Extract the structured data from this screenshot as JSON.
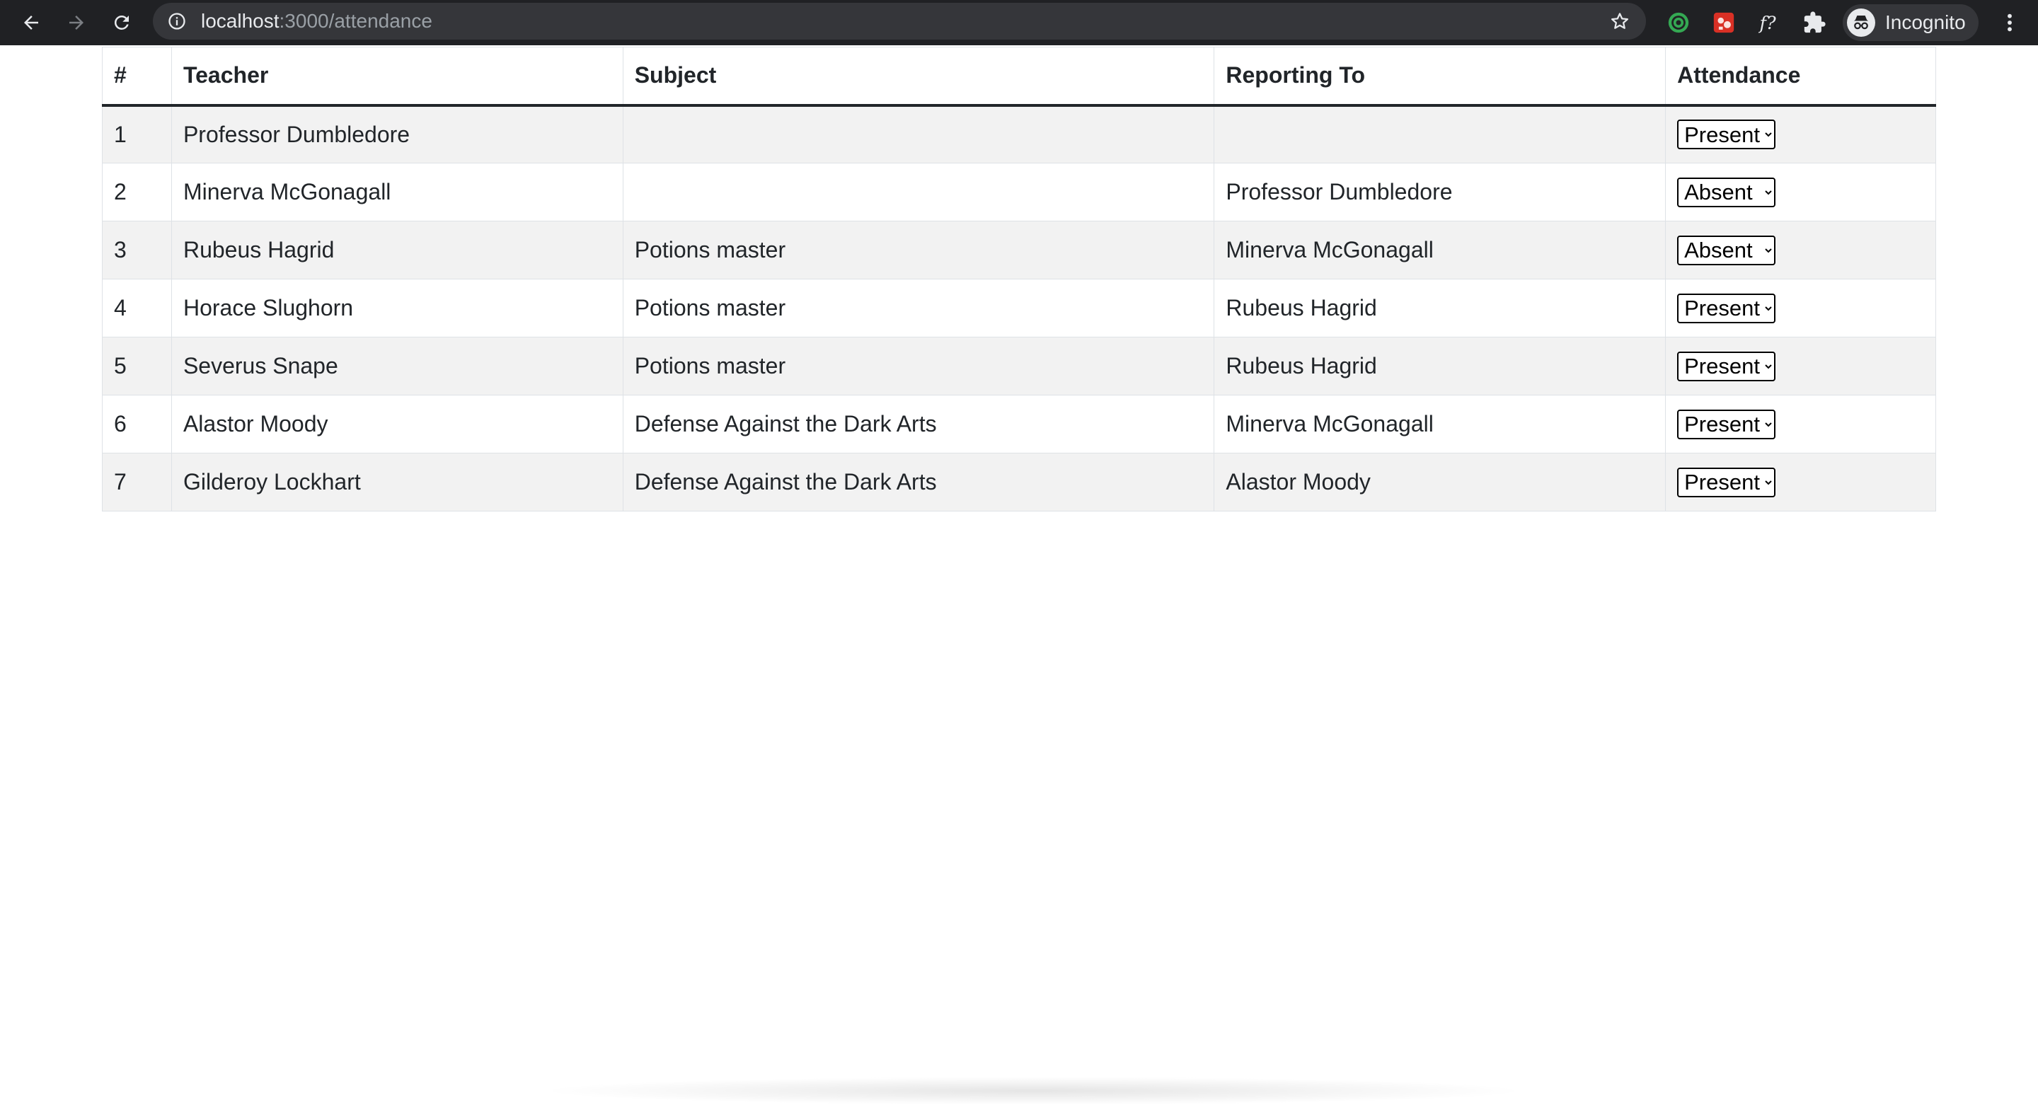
{
  "browser": {
    "url_host": "localhost",
    "url_path": ":3000/attendance",
    "profile_label": "Incognito",
    "extension_icons": [
      "target-extension-icon",
      "red-extension-icon",
      "function-extension-icon",
      "puzzle-extensions-icon"
    ]
  },
  "table": {
    "headers": {
      "num": "#",
      "teacher": "Teacher",
      "subject": "Subject",
      "reporting_to": "Reporting To",
      "attendance": "Attendance"
    },
    "attendance_options": [
      "Present",
      "Absent"
    ],
    "rows": [
      {
        "num": "1",
        "teacher": "Professor Dumbledore",
        "subject": "",
        "reporting_to": "",
        "attendance": "Present"
      },
      {
        "num": "2",
        "teacher": "Minerva McGonagall",
        "subject": "",
        "reporting_to": "Professor Dumbledore",
        "attendance": "Absent"
      },
      {
        "num": "3",
        "teacher": "Rubeus Hagrid",
        "subject": "Potions master",
        "reporting_to": "Minerva McGonagall",
        "attendance": "Absent"
      },
      {
        "num": "4",
        "teacher": "Horace Slughorn",
        "subject": "Potions master",
        "reporting_to": "Rubeus Hagrid",
        "attendance": "Present"
      },
      {
        "num": "5",
        "teacher": "Severus Snape",
        "subject": "Potions master",
        "reporting_to": "Rubeus Hagrid",
        "attendance": "Present"
      },
      {
        "num": "6",
        "teacher": "Alastor Moody",
        "subject": "Defense Against the Dark Arts",
        "reporting_to": "Minerva McGonagall",
        "attendance": "Present"
      },
      {
        "num": "7",
        "teacher": "Gilderoy Lockhart",
        "subject": "Defense Against the Dark Arts",
        "reporting_to": "Alastor Moody",
        "attendance": "Present"
      }
    ]
  }
}
